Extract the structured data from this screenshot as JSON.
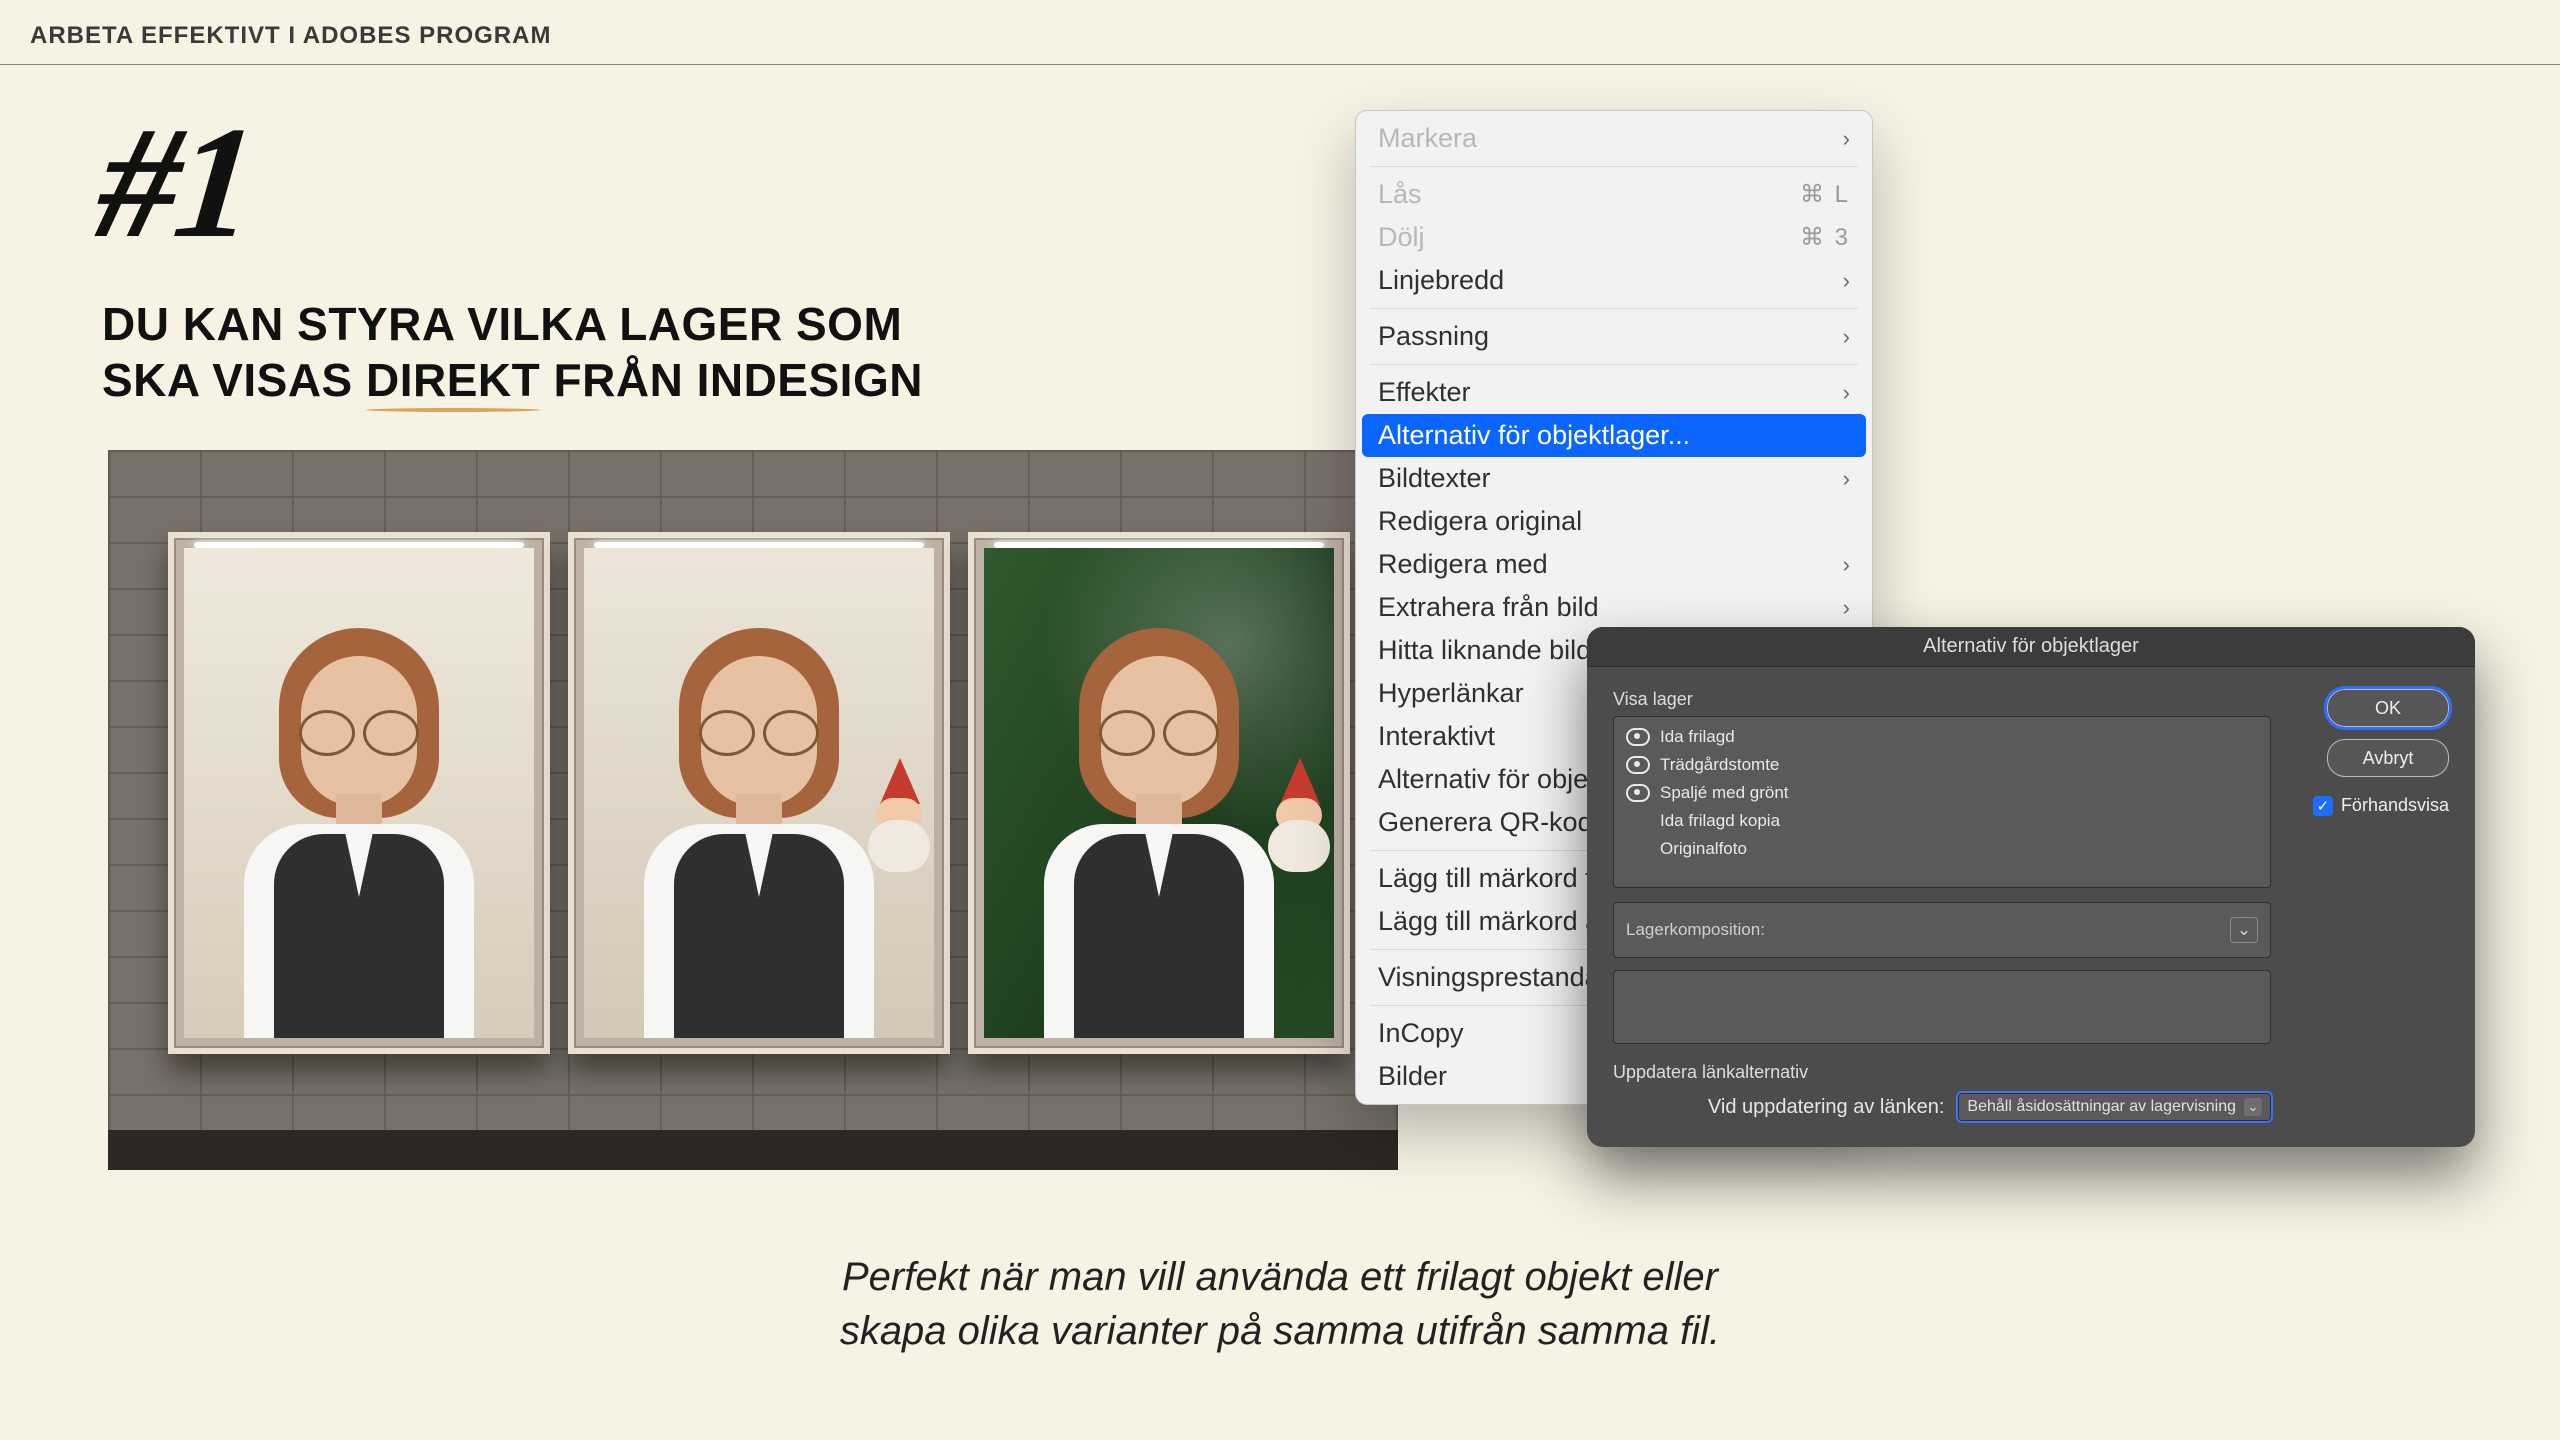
{
  "page": {
    "topbar": "ARBETA EFFEKTIVT I ADOBES PROGRAM",
    "tip_number": "#1",
    "headline_before": "DU KAN STYRA VILKA LAGER SOM SKA VISAS ",
    "headline_underlined": "DIREKT",
    "headline_after": " FRÅN INDESIGN",
    "caption_line1": "Perfekt när man vill använda ett frilagt objekt eller",
    "caption_line2": "skapa olika varianter på samma utifrån samma fil."
  },
  "menu": {
    "items": [
      {
        "label": "Markera",
        "state": "disabled",
        "submenu": true
      },
      {
        "sep": true
      },
      {
        "label": "Lås",
        "state": "disabled",
        "shortcut": "⌘ L"
      },
      {
        "label": "Dölj",
        "state": "disabled",
        "shortcut": "⌘ 3"
      },
      {
        "label": "Linjebredd",
        "submenu": true
      },
      {
        "sep": true
      },
      {
        "label": "Passning",
        "submenu": true
      },
      {
        "sep": true
      },
      {
        "label": "Effekter",
        "submenu": true
      },
      {
        "label": "Alternativ för objektlager...",
        "selected": true
      },
      {
        "label": "Bildtexter",
        "submenu": true
      },
      {
        "label": "Redigera original"
      },
      {
        "label": "Redigera med",
        "submenu": true
      },
      {
        "label": "Extrahera från bild",
        "submenu": true
      },
      {
        "label": "Hitta liknande bilder"
      },
      {
        "label": "Hyperlänkar",
        "submenu": true
      },
      {
        "label": "Interaktivt",
        "submenu": true
      },
      {
        "label": "Alternativ för objektexport..."
      },
      {
        "label": "Generera QR-kod..."
      },
      {
        "sep": true
      },
      {
        "label": "Lägg till märkord till ram"
      },
      {
        "label": "Lägg till märkord automatiskt"
      },
      {
        "sep": true
      },
      {
        "label": "Visningsprestanda",
        "submenu": true
      },
      {
        "sep": true
      },
      {
        "label": "InCopy",
        "submenu": true
      },
      {
        "label": "Bilder",
        "submenu": true
      }
    ]
  },
  "dialog": {
    "title": "Alternativ för objektlager",
    "section_label": "Visa lager",
    "layers": [
      {
        "name": "Ida frilagd",
        "visible": true
      },
      {
        "name": "Trädgårdstomte",
        "visible": true
      },
      {
        "name": "Spaljé med grönt",
        "visible": true
      },
      {
        "name": "Ida frilagd kopia",
        "visible": false
      },
      {
        "name": "Originalfoto",
        "visible": false
      }
    ],
    "layer_comp_label": "Lagerkomposition:",
    "update_section_label": "Uppdatera länkalternativ",
    "update_row_label": "Vid uppdatering av länken:",
    "update_select_value": "Behåll åsidosättningar av lagervisning",
    "buttons": {
      "ok": "OK",
      "cancel": "Avbryt"
    },
    "preview_label": "Förhandsvisa",
    "preview_checked": true
  }
}
